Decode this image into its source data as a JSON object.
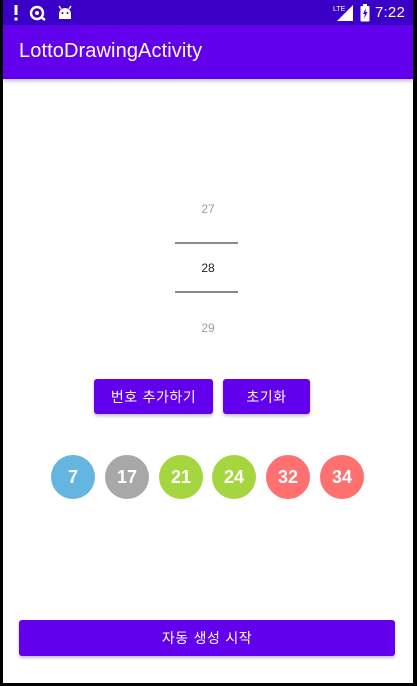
{
  "status_bar": {
    "time": "7:22",
    "network_label": "LTE",
    "icons": [
      "alert-icon",
      "sync-icon",
      "android-icon",
      "signal-icon",
      "battery-icon"
    ],
    "background": "#3a00c8"
  },
  "app_bar": {
    "title": "LottoDrawingActivity",
    "background": "#6200ee"
  },
  "number_picker": {
    "previous": "27",
    "current": "28",
    "next": "29"
  },
  "buttons": {
    "add_number": "번호 추가하기",
    "reset": "초기화",
    "auto_generate": "자동 생성 시작",
    "color": "#6200ee"
  },
  "balls": [
    {
      "number": "7",
      "color": "#64b5e0"
    },
    {
      "number": "17",
      "color": "#a8a8a8"
    },
    {
      "number": "21",
      "color": "#a6d63f"
    },
    {
      "number": "24",
      "color": "#a6d63f"
    },
    {
      "number": "32",
      "color": "#ff7070"
    },
    {
      "number": "34",
      "color": "#ff7070"
    }
  ]
}
